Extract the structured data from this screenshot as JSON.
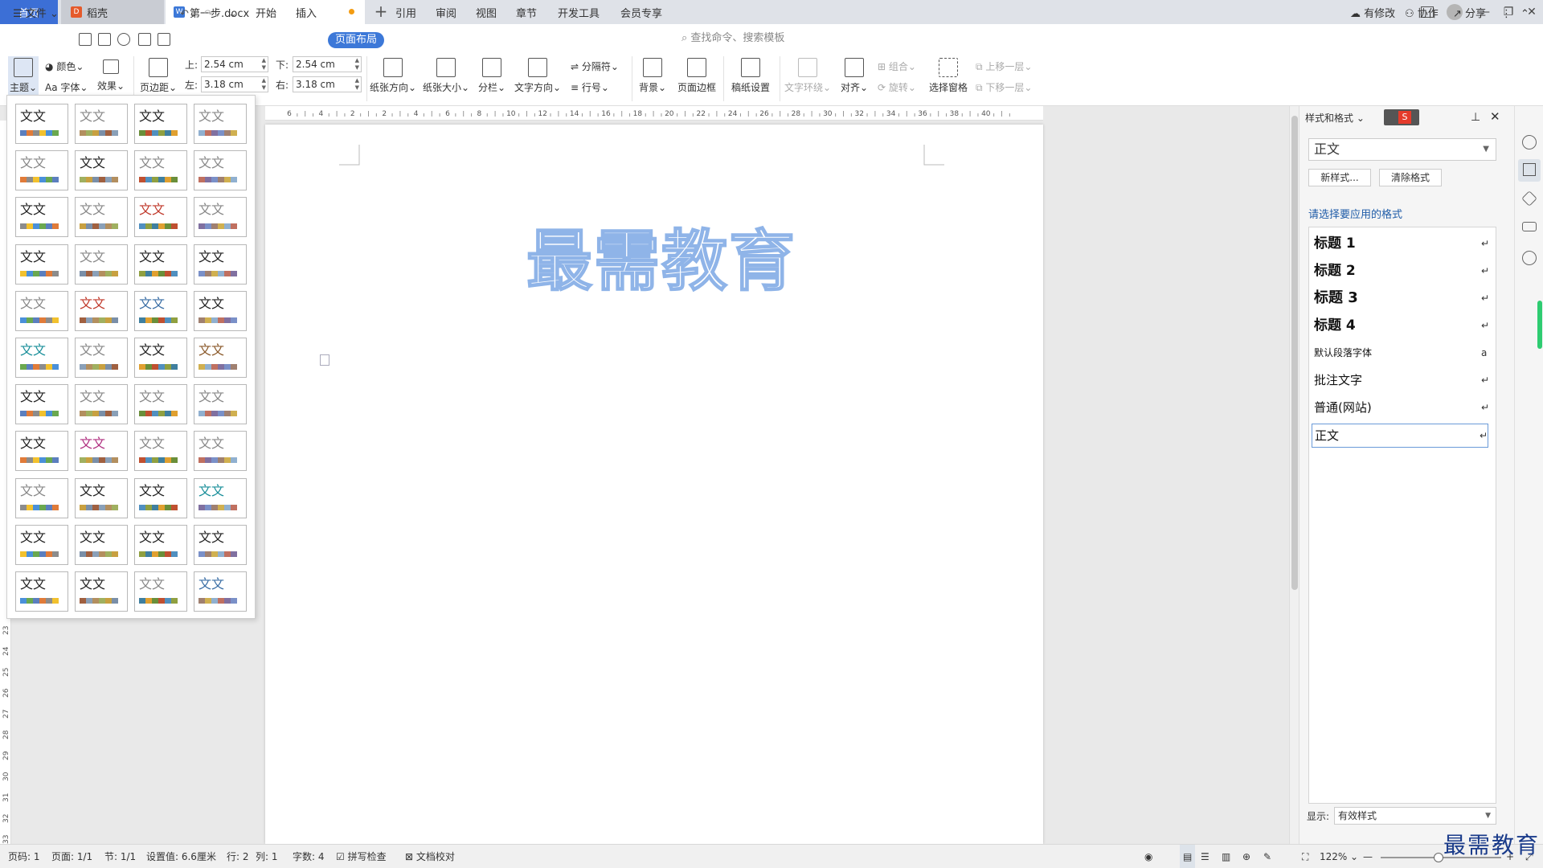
{
  "tabs": {
    "home": "首页",
    "daoke": "稻壳",
    "doc": "第一步.docx",
    "add": "+"
  },
  "window": {
    "minimize": "—",
    "restore": "❐",
    "close": "✕"
  },
  "menu": {
    "file": "文件",
    "items": [
      "开始",
      "插入",
      "页面布局",
      "引用",
      "审阅",
      "视图",
      "章节",
      "开发工具",
      "会员专享"
    ],
    "active": "页面布局",
    "search": "查找命令、搜索模板",
    "right": [
      "有修改",
      "协作",
      "分享"
    ]
  },
  "ribbon": {
    "theme": "主题",
    "color": "颜色",
    "font": "Aa 字体",
    "effect": "效果",
    "margins": "页边距",
    "top_label": "上:",
    "top_val": "2.54 cm",
    "bottom_label": "下:",
    "bottom_val": "2.54 cm",
    "left_label": "左:",
    "left_val": "3.18 cm",
    "right_label": "右:",
    "right_val": "3.18 cm",
    "orientation": "纸张方向",
    "size": "纸张大小",
    "columns": "分栏",
    "text_dir": "文字方向",
    "break": "分隔符",
    "line_num": "行号",
    "background": "背景",
    "border": "页面边框",
    "manuscript": "稿纸设置",
    "wrap": "文字环绕",
    "align": "对齐",
    "group": "组合",
    "rotate": "旋转",
    "select_pane": "选择窗格",
    "up": "上移一层",
    "down": "下移一层"
  },
  "ruler": {
    "h": [
      "6",
      "4",
      "2",
      "2",
      "4",
      "6",
      "8",
      "10",
      "12",
      "14",
      "16",
      "18",
      "20",
      "22",
      "24",
      "26",
      "28",
      "30",
      "32",
      "34",
      "36",
      "38",
      "40"
    ],
    "v": [
      "23",
      "24",
      "25",
      "26",
      "27",
      "28",
      "29",
      "30",
      "31",
      "32",
      "33"
    ]
  },
  "document": {
    "wordart": "最需教育"
  },
  "gallery": {
    "label": "文文",
    "colors": {
      "dark": "#222222",
      "gray": "#888888",
      "red": "#c0392b",
      "teal": "#1a8f9a",
      "blue": "#3a6ea5",
      "brown": "#8b5a2b",
      "magenta": "#b03080"
    },
    "palettes": [
      [
        "#5b7fbf",
        "#e07b39",
        "#8c8c8c",
        "#f2c12e",
        "#4a90d9",
        "#6aa84f"
      ],
      [
        "#8aa0b8",
        "#b38f5f",
        "#a0b060",
        "#c8a040",
        "#7a8fa8",
        "#a06040"
      ],
      [
        "#3f7f9f",
        "#e0a030",
        "#6a8f3a",
        "#c05030",
        "#5090c0",
        "#90a040"
      ],
      [
        "#7a90c8",
        "#a08070",
        "#d0b050",
        "#90b0d0",
        "#c07060",
        "#8070a0"
      ]
    ]
  },
  "pane": {
    "title": "样式和格式",
    "current": "正文",
    "new_style": "新样式...",
    "clear": "清除格式",
    "prompt": "请选择要应用的格式",
    "styles": [
      {
        "name": "标题 1",
        "mark": "↵"
      },
      {
        "name": "标题 2",
        "mark": "↵"
      },
      {
        "name": "标题 3",
        "mark": "↵"
      },
      {
        "name": "标题 4",
        "mark": "↵"
      },
      {
        "name": "默认段落字体",
        "mark": "a"
      },
      {
        "name": "批注文字",
        "mark": "↵"
      },
      {
        "name": "普通(网站)",
        "mark": "↵"
      },
      {
        "name": "正文",
        "mark": "↵"
      }
    ],
    "show_label": "显示:",
    "show_value": "有效样式"
  },
  "status": {
    "page": "页码: 1",
    "pages": "页面: 1/1",
    "section": "节: 1/1",
    "setting": "设置值: 6.6厘米",
    "row": "行: 2",
    "col": "列: 1",
    "words": "字数: 4",
    "spell": "拼写检查",
    "proof": "文档校对",
    "zoom": "122%"
  },
  "watermark": "最需教育"
}
